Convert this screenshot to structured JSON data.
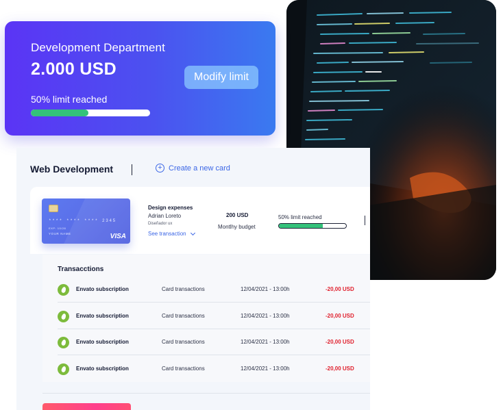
{
  "budget_card": {
    "department": "Development Department",
    "amount": "2.000 USD",
    "modify_label": "Modify limit",
    "limit_text": "50% limit reached",
    "progress": 0.48
  },
  "panel": {
    "title": "Web Development",
    "create_label": "Create a new card",
    "card": {
      "number": "**** **** **** 2345",
      "expiry": "EXP: 10/28",
      "holder": "YOUR NAME",
      "brand": "VISA"
    },
    "expense": {
      "title": "Design expenses",
      "owner": "Adrian Loreto",
      "role": "Diseñador ux",
      "see_transaction": "See transaction"
    },
    "budget": {
      "value": "200 USD",
      "label": "Montlhy budget"
    },
    "limit": {
      "label": "50% limit reached",
      "progress": 0.65
    },
    "transactions": {
      "title": "Transacctions",
      "rows": [
        {
          "name": "Envato subscription",
          "type": "Card transactions",
          "date": "12/04/2021 - 13:00h",
          "amount": "-20,00 USD"
        },
        {
          "name": "Envato subscription",
          "type": "Card transactions",
          "date": "12/04/2021 - 13:00h",
          "amount": "-20,00 USD"
        },
        {
          "name": "Envato subscription",
          "type": "Card transactions",
          "date": "12/04/2021 - 13:00h",
          "amount": "-20,00 USD"
        },
        {
          "name": "Envato subscription",
          "type": "Card transactions",
          "date": "12/04/2021 - 13:00h",
          "amount": "-20,00 USD"
        }
      ]
    }
  },
  "colors": {
    "accent_blue": "#3b66e6",
    "progress_green": "#34c27a",
    "negative_red": "#e0202d",
    "envato_green": "#7dbb3c"
  },
  "icons": {
    "create": "plus-circle-icon",
    "see_transaction": "chevron-down-icon",
    "transaction": "envato-icon",
    "card_chip": "card-chip-icon"
  }
}
